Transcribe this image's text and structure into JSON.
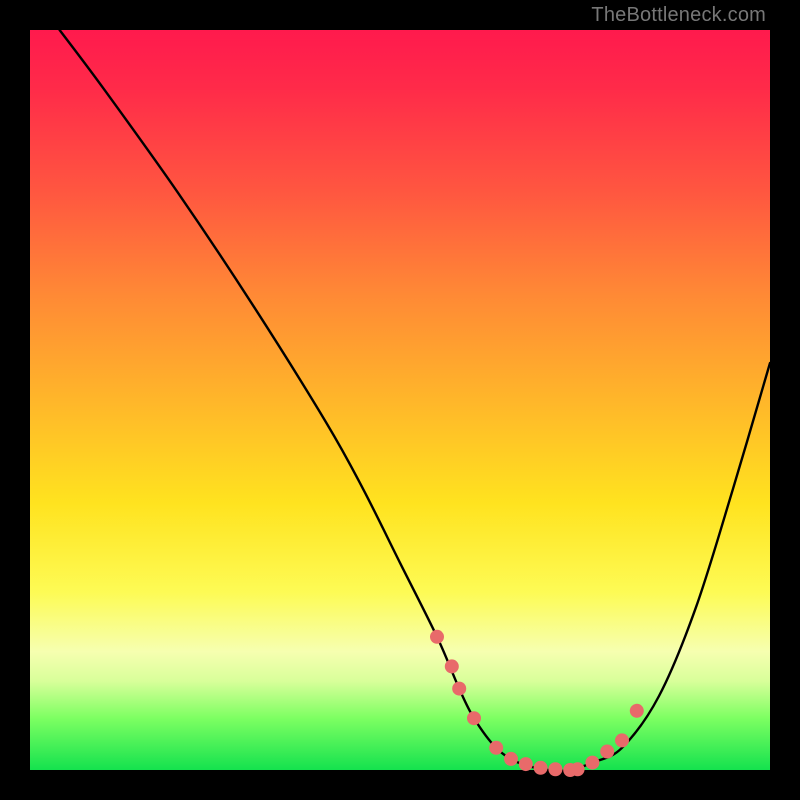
{
  "watermark": "TheBottleneck.com",
  "chart_data": {
    "type": "line",
    "title": "",
    "xlabel": "",
    "ylabel": "",
    "xlim": [
      0,
      100
    ],
    "ylim": [
      0,
      100
    ],
    "series": [
      {
        "name": "bottleneck-curve",
        "x": [
          4,
          10,
          20,
          30,
          40,
          45,
          50,
          55,
          58,
          60,
          63,
          66,
          70,
          73,
          76,
          80,
          85,
          90,
          95,
          100
        ],
        "y": [
          100,
          92,
          78,
          63,
          47,
          38,
          28,
          18,
          11,
          7,
          3,
          1,
          0,
          0,
          1,
          3,
          10,
          22,
          38,
          55
        ]
      }
    ],
    "markers": {
      "name": "highlight-dots",
      "color": "#e86a6a",
      "x": [
        55,
        57,
        58,
        60,
        63,
        65,
        67,
        69,
        71,
        73,
        74,
        76,
        78,
        80,
        82
      ],
      "y": [
        18,
        14,
        11,
        7,
        3,
        1.5,
        0.8,
        0.3,
        0.1,
        0,
        0.1,
        1,
        2.5,
        4,
        8
      ]
    },
    "gradient_stops": [
      {
        "pos": 0,
        "color": "#ff1a4d"
      },
      {
        "pos": 22,
        "color": "#ff5740"
      },
      {
        "pos": 50,
        "color": "#ffb62a"
      },
      {
        "pos": 76,
        "color": "#fdfb55"
      },
      {
        "pos": 93,
        "color": "#7dff62"
      },
      {
        "pos": 100,
        "color": "#14e24e"
      }
    ]
  }
}
